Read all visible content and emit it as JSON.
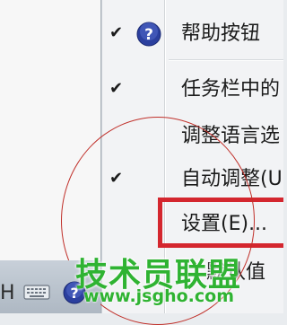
{
  "menu": {
    "items": [
      {
        "label": "帮助按钮",
        "checked": true,
        "icon": "help-icon"
      },
      {
        "label": "任务栏中的",
        "checked": true
      },
      {
        "label": "调整语言选",
        "checked": false
      },
      {
        "label": "自动调整(U",
        "checked": true
      },
      {
        "label": "设置(E)...",
        "checked": false,
        "highlighted": true
      },
      {
        "label": "还原默认值",
        "checked": false,
        "partial": "默认值"
      }
    ],
    "check_glyph": "✔"
  },
  "taskbar": {
    "language_text": "H",
    "icons": [
      "keyboard-icon",
      "help-icon"
    ]
  },
  "watermark": {
    "title": "技术员联盟",
    "url": "www.jsgho.com"
  },
  "colors": {
    "highlight_border": "#d4262e",
    "annotation_circle": "#c0302a",
    "watermark": "#2fb332",
    "help_icon": "#2b3f9e"
  }
}
